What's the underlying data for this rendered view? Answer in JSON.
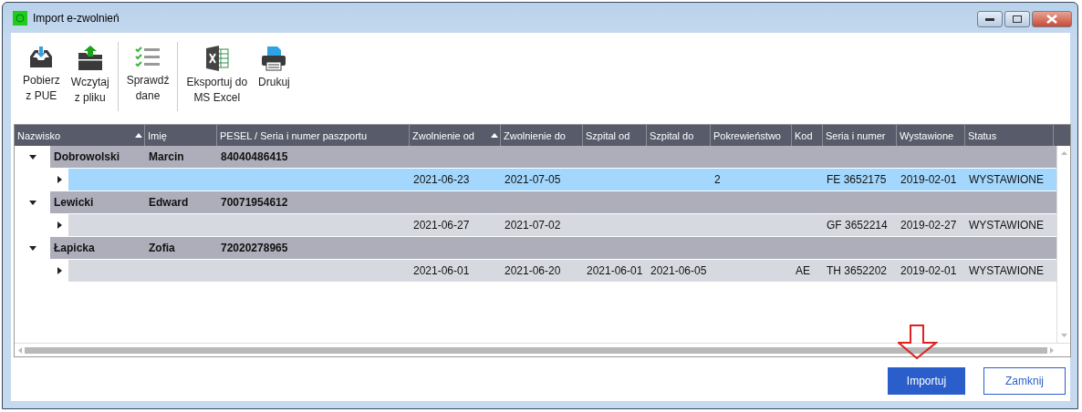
{
  "window": {
    "title": "Import e-zwolnień"
  },
  "toolbar": [
    {
      "label": "Pobierz\nz PUE"
    },
    {
      "label": "Wczytaj\nz pliku"
    },
    {
      "label": "Sprawdź\ndane"
    },
    {
      "label": "Eksportuj do\nMS Excel"
    },
    {
      "label": "Drukuj"
    }
  ],
  "table": {
    "columns": [
      {
        "label": "Nazwisko",
        "sorted": true
      },
      {
        "label": "Imię",
        "sorted": false
      },
      {
        "label": "PESEL / Seria i numer paszportu",
        "sorted": false
      },
      {
        "label": "Zwolnienie od",
        "sorted": true
      },
      {
        "label": "Zwolnienie do",
        "sorted": false
      },
      {
        "label": "Szpital od",
        "sorted": false
      },
      {
        "label": "Szpital do",
        "sorted": false
      },
      {
        "label": "Pokrewieństwo",
        "sorted": false
      },
      {
        "label": "Kod",
        "sorted": false
      },
      {
        "label": "Seria i numer",
        "sorted": false
      },
      {
        "label": "Wystawione",
        "sorted": false
      },
      {
        "label": "Status",
        "sorted": false
      }
    ],
    "groups": [
      {
        "surname": "Dobrowolski",
        "first_name": "Marcin",
        "pesel": "84040486415",
        "expanded": true,
        "rows": [
          {
            "selected": true,
            "expanded": false,
            "sick_leave_from": "2021-06-23",
            "sick_leave_to": "2021-07-05",
            "kinship": "2",
            "series_number": "FE 3652175",
            "issued": "2019-02-01",
            "status": "WYSTAWIONE"
          }
        ]
      },
      {
        "surname": "Lewicki",
        "first_name": "Edward",
        "pesel": "70071954612",
        "expanded": true,
        "rows": [
          {
            "selected": false,
            "expanded": false,
            "sick_leave_from": "2021-06-27",
            "sick_leave_to": "2021-07-02",
            "series_number": "GF 3652214",
            "issued": "2019-02-27",
            "status": "WYSTAWIONE"
          }
        ]
      },
      {
        "surname": "Łapicka",
        "first_name": "Zofia",
        "pesel": "72020278965",
        "expanded": true,
        "rows": [
          {
            "selected": false,
            "expanded": false,
            "sick_leave_from": "2021-06-01",
            "sick_leave_to": "2021-06-20",
            "hospital_from": "2021-06-01",
            "hospital_to": "2021-06-05",
            "code": "AE",
            "series_number": "TH 3652202",
            "issued": "2019-02-01",
            "status": "WYSTAWIONE"
          }
        ]
      }
    ]
  },
  "buttons": [
    {
      "label": "Importuj",
      "kind": "primary"
    },
    {
      "label": "Zamknij",
      "kind": "secondary"
    }
  ]
}
